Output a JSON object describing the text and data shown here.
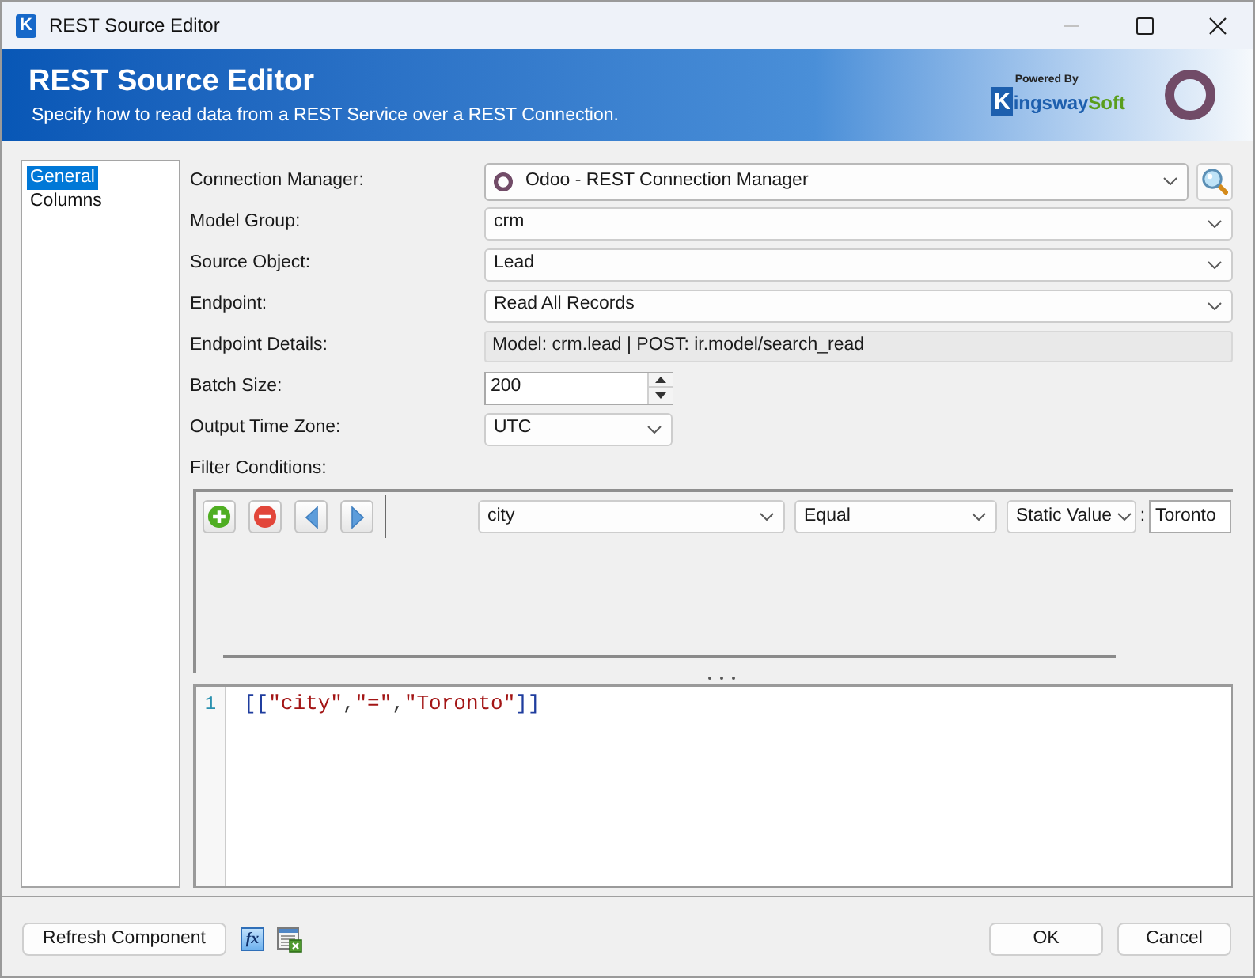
{
  "window": {
    "app_icon": "K",
    "title": "REST Source Editor",
    "minimize_disabled": true
  },
  "header": {
    "title": "REST Source Editor",
    "subtitle": "Specify how to read data from a REST Service over a REST Connection.",
    "logo": {
      "powered_by": "Powered By",
      "initial": "K",
      "name": "ingsway",
      "suffix": "Soft"
    }
  },
  "sidebar": {
    "items": [
      {
        "label": "General",
        "selected": true
      },
      {
        "label": "Columns",
        "selected": false
      }
    ]
  },
  "fields": [
    {
      "kind": "connection",
      "label": "Connection Manager:",
      "value": "Odoo - REST Connection Manager"
    },
    {
      "kind": "dropdown",
      "label": "Model Group:",
      "value": "crm"
    },
    {
      "kind": "dropdown",
      "label": "Source Object:",
      "value": "Lead"
    },
    {
      "kind": "dropdown",
      "label": "Endpoint:",
      "value": "Read All Records"
    },
    {
      "kind": "readonly",
      "label": "Endpoint Details:",
      "value": "Model: crm.lead | POST: ir.model/search_read"
    },
    {
      "kind": "spinner",
      "label": "Batch Size:",
      "value": "200"
    },
    {
      "kind": "short_dropdown",
      "label": "Output Time Zone:",
      "value": "UTC"
    }
  ],
  "filter": {
    "label": "Filter Conditions:",
    "conditions": [
      {
        "field": "city",
        "operator": "Equal",
        "value_type": "Static Value",
        "separator": ":",
        "value": "Toronto"
      }
    ]
  },
  "editor": {
    "lines": [
      {
        "number": "1",
        "tokens": [
          {
            "kind": "bracket",
            "text": "[["
          },
          {
            "kind": "string",
            "text": "\"city\""
          },
          {
            "kind": "punct",
            "text": ","
          },
          {
            "kind": "string",
            "text": "\"=\""
          },
          {
            "kind": "punct",
            "text": ","
          },
          {
            "kind": "string",
            "text": "\"Toronto\""
          },
          {
            "kind": "bracket",
            "text": "]]"
          }
        ]
      }
    ]
  },
  "footer": {
    "refresh_button": "Refresh Component",
    "expression_button": "fx",
    "buttons": [
      "OK",
      "Cancel"
    ]
  }
}
